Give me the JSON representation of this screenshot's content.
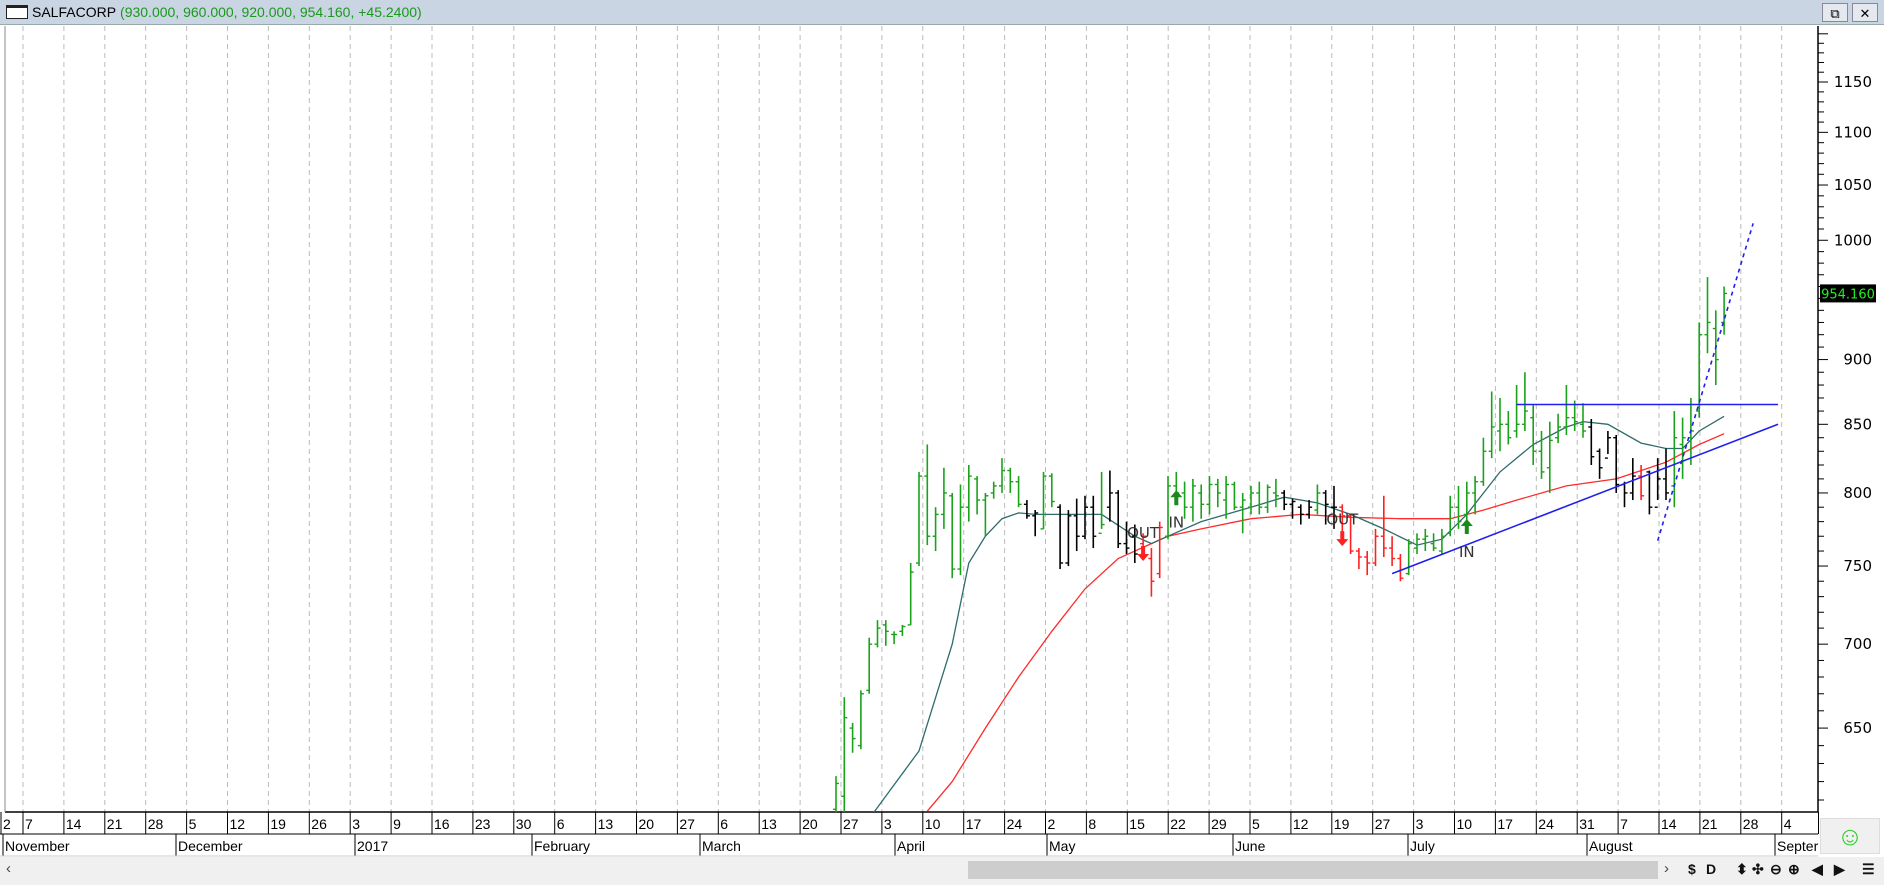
{
  "window": {
    "symbol": "SALFACORP",
    "quote": "(930.000, 960.000, 920.000, 954.160, +45.2400)",
    "restore_icon": "restore-icon",
    "close_icon": "close-icon"
  },
  "colors": {
    "up": "#1aa31a",
    "flat": "#000000",
    "down": "#ff2020",
    "ma_fast": "#2f6b6b",
    "ma_slow": "#ff2a2a",
    "trendline": "#2020ee",
    "grid": "#bbbbbb"
  },
  "chart_data": {
    "type": "ohlc",
    "title": "SALFACORP",
    "yscale": "log",
    "ylim": [
      604,
      1204
    ],
    "yticks": [
      650,
      700,
      750,
      800,
      850,
      900,
      1000,
      1050,
      1100,
      1150
    ],
    "last_price": "954.160",
    "week_labels": [
      "2",
      "7",
      "14",
      "21",
      "28",
      "5",
      "12",
      "19",
      "26",
      "3",
      "9",
      "16",
      "23",
      "30",
      "6",
      "13",
      "20",
      "27",
      "6",
      "13",
      "20",
      "27",
      "3",
      "10",
      "17",
      "24",
      "2",
      "8",
      "15",
      "22",
      "29",
      "5",
      "12",
      "19",
      "27",
      "3",
      "10",
      "17",
      "24",
      "31",
      "7",
      "14",
      "21",
      "28",
      "4"
    ],
    "month_labels": [
      "November",
      "December",
      "2017",
      "February",
      "March",
      "April",
      "May",
      "June",
      "July",
      "August",
      "Septer"
    ],
    "bars": [
      [
        605,
        623,
        598,
        619,
        "g"
      ],
      [
        612,
        668,
        600,
        656,
        "g"
      ],
      [
        650,
        653,
        636,
        644,
        "g"
      ],
      [
        640,
        672,
        638,
        670,
        "g"
      ],
      [
        672,
        704,
        670,
        700,
        "g"
      ],
      [
        700,
        715,
        698,
        710,
        "g"
      ],
      [
        712,
        715,
        699,
        708,
        "g"
      ],
      [
        706,
        708,
        700,
        706,
        "g"
      ],
      [
        708,
        712,
        705,
        711,
        "g"
      ],
      [
        712,
        752,
        712,
        746,
        "g"
      ],
      [
        752,
        815,
        750,
        812,
        "g"
      ],
      [
        812,
        835,
        764,
        770,
        "g"
      ],
      [
        770,
        790,
        760,
        785,
        "g"
      ],
      [
        785,
        818,
        775,
        800,
        "g"
      ],
      [
        798,
        800,
        742,
        748,
        "g"
      ],
      [
        748,
        806,
        744,
        790,
        "g"
      ],
      [
        790,
        820,
        780,
        812,
        "g"
      ],
      [
        810,
        812,
        785,
        795,
        "g"
      ],
      [
        795,
        800,
        770,
        798,
        "g"
      ],
      [
        800,
        808,
        796,
        805,
        "g"
      ],
      [
        805,
        825,
        800,
        816,
        "g"
      ],
      [
        816,
        818,
        800,
        808,
        "g"
      ],
      [
        808,
        812,
        790,
        792,
        "g"
      ],
      [
        792,
        795,
        782,
        784,
        "k"
      ],
      [
        784,
        788,
        770,
        786,
        "k"
      ],
      [
        775,
        815,
        775,
        812,
        "g"
      ],
      [
        812,
        814,
        790,
        794,
        "g"
      ],
      [
        790,
        792,
        748,
        752,
        "k"
      ],
      [
        752,
        788,
        750,
        784,
        "k"
      ],
      [
        784,
        796,
        760,
        770,
        "k"
      ],
      [
        770,
        798,
        768,
        790,
        "k"
      ],
      [
        790,
        798,
        762,
        770,
        "k"
      ],
      [
        772,
        815,
        775,
        778,
        "g"
      ],
      [
        790,
        816,
        780,
        800,
        "k"
      ],
      [
        800,
        802,
        762,
        765,
        "k"
      ],
      [
        765,
        780,
        758,
        762,
        "k"
      ],
      [
        770,
        778,
        752,
        758,
        "k"
      ],
      [
        765,
        772,
        758,
        770,
        "r"
      ],
      [
        755,
        762,
        730,
        740,
        "r"
      ],
      [
        745,
        780,
        742,
        776,
        "r"
      ],
      [
        770,
        812,
        768,
        805,
        "g"
      ],
      [
        805,
        815,
        795,
        800,
        "g"
      ],
      [
        800,
        808,
        782,
        790,
        "g"
      ],
      [
        790,
        810,
        780,
        805,
        "g"
      ],
      [
        800,
        806,
        782,
        792,
        "g"
      ],
      [
        792,
        812,
        785,
        806,
        "g"
      ],
      [
        806,
        810,
        790,
        800,
        "g"
      ],
      [
        795,
        812,
        782,
        806,
        "g"
      ],
      [
        806,
        808,
        788,
        790,
        "g"
      ],
      [
        790,
        800,
        772,
        795,
        "g"
      ],
      [
        790,
        805,
        785,
        800,
        "g"
      ],
      [
        800,
        808,
        785,
        790,
        "g"
      ],
      [
        790,
        806,
        786,
        804,
        "g"
      ],
      [
        800,
        810,
        790,
        798,
        "g"
      ],
      [
        800,
        802,
        788,
        792,
        "k"
      ],
      [
        792,
        796,
        782,
        794,
        "k"
      ],
      [
        790,
        792,
        778,
        785,
        "k"
      ],
      [
        785,
        795,
        782,
        790,
        "k"
      ],
      [
        788,
        806,
        785,
        800,
        "g"
      ],
      [
        800,
        802,
        778,
        792,
        "k"
      ],
      [
        790,
        805,
        775,
        790,
        "k"
      ],
      [
        790,
        792,
        770,
        784,
        "r"
      ],
      [
        784,
        785,
        758,
        760,
        "r"
      ],
      [
        760,
        762,
        748,
        756,
        "r"
      ],
      [
        756,
        760,
        744,
        752,
        "r"
      ],
      [
        752,
        775,
        750,
        770,
        "r"
      ],
      [
        770,
        798,
        756,
        762,
        "r"
      ],
      [
        762,
        770,
        750,
        755,
        "r"
      ],
      [
        755,
        758,
        740,
        742,
        "r"
      ],
      [
        745,
        768,
        744,
        765,
        "g"
      ],
      [
        762,
        772,
        758,
        768,
        "g"
      ],
      [
        768,
        775,
        760,
        770,
        "g"
      ],
      [
        765,
        772,
        760,
        762,
        "g"
      ],
      [
        760,
        775,
        758,
        770,
        "g"
      ],
      [
        772,
        798,
        770,
        790,
        "g"
      ],
      [
        790,
        805,
        775,
        780,
        "g"
      ],
      [
        785,
        808,
        780,
        800,
        "g"
      ],
      [
        800,
        812,
        785,
        808,
        "g"
      ],
      [
        808,
        840,
        805,
        830,
        "g"
      ],
      [
        830,
        875,
        825,
        848,
        "g"
      ],
      [
        845,
        870,
        830,
        850,
        "g"
      ],
      [
        850,
        860,
        835,
        840,
        "g"
      ],
      [
        845,
        880,
        840,
        850,
        "g"
      ],
      [
        850,
        890,
        845,
        860,
        "g"
      ],
      [
        855,
        865,
        820,
        830,
        "g"
      ],
      [
        830,
        845,
        810,
        815,
        "g"
      ],
      [
        818,
        852,
        800,
        838,
        "g"
      ],
      [
        840,
        858,
        836,
        848,
        "g"
      ],
      [
        848,
        880,
        842,
        855,
        "g"
      ],
      [
        855,
        868,
        845,
        852,
        "g"
      ],
      [
        850,
        866,
        840,
        845,
        "g"
      ],
      [
        848,
        854,
        820,
        826,
        "k"
      ],
      [
        830,
        832,
        810,
        818,
        "k"
      ],
      [
        825,
        845,
        828,
        840,
        "k"
      ],
      [
        840,
        842,
        800,
        806,
        "k"
      ],
      [
        806,
        808,
        790,
        800,
        "k"
      ],
      [
        800,
        825,
        795,
        812,
        "k"
      ],
      [
        812,
        820,
        795,
        798,
        "r"
      ],
      [
        815,
        816,
        785,
        790,
        "k"
      ],
      [
        790,
        825,
        795,
        810,
        "k"
      ],
      [
        810,
        832,
        795,
        800,
        "k"
      ],
      [
        805,
        860,
        790,
        840,
        "g"
      ],
      [
        835,
        855,
        810,
        840,
        "g"
      ],
      [
        840,
        870,
        820,
        845,
        "g"
      ],
      [
        860,
        930,
        855,
        920,
        "g"
      ],
      [
        920,
        968,
        905,
        930,
        "g"
      ],
      [
        925,
        940,
        880,
        900,
        "g"
      ],
      [
        930,
        960,
        920,
        954.16,
        "g"
      ]
    ],
    "ma_fast": [
      [
        4,
        600
      ],
      [
        10,
        637
      ],
      [
        14,
        700
      ],
      [
        16,
        752
      ],
      [
        18,
        770
      ],
      [
        20,
        782
      ],
      [
        22,
        786
      ],
      [
        24,
        785
      ],
      [
        32,
        785
      ],
      [
        36,
        770
      ],
      [
        38,
        765
      ],
      [
        40,
        770
      ],
      [
        44,
        780
      ],
      [
        50,
        790
      ],
      [
        54,
        797
      ],
      [
        58,
        793
      ],
      [
        62,
        785
      ],
      [
        66,
        775
      ],
      [
        70,
        764
      ],
      [
        73,
        768
      ],
      [
        76,
        785
      ],
      [
        80,
        815
      ],
      [
        84,
        835
      ],
      [
        88,
        848
      ],
      [
        90,
        852
      ],
      [
        93,
        850
      ],
      [
        97,
        836
      ],
      [
        100,
        832
      ],
      [
        102,
        832
      ],
      [
        104,
        845
      ],
      [
        107,
        856
      ]
    ],
    "ma_slow": [
      [
        11,
        604
      ],
      [
        14,
        620
      ],
      [
        18,
        650
      ],
      [
        22,
        680
      ],
      [
        26,
        708
      ],
      [
        30,
        735
      ],
      [
        34,
        755
      ],
      [
        38,
        765
      ],
      [
        40,
        770
      ],
      [
        44,
        775
      ],
      [
        50,
        782
      ],
      [
        56,
        785
      ],
      [
        62,
        783
      ],
      [
        68,
        782
      ],
      [
        74,
        782
      ],
      [
        78,
        788
      ],
      [
        82,
        795
      ],
      [
        88,
        805
      ],
      [
        94,
        810
      ],
      [
        100,
        822
      ],
      [
        104,
        835
      ],
      [
        107,
        843
      ]
    ],
    "trendlines": [
      {
        "from": [
          82,
          865
        ],
        "to": [
          113.5,
          865
        ],
        "style": "solid"
      },
      {
        "from": [
          67,
          745
        ],
        "to": [
          113.5,
          850
        ],
        "style": "solid"
      },
      {
        "from": [
          99,
          767
        ],
        "to": [
          110.5,
          1015
        ],
        "style": "dotted"
      }
    ],
    "signals": [
      {
        "label": "OUT",
        "index": 37,
        "text_price": 773,
        "arrow_price": 758,
        "dir": "down"
      },
      {
        "label": "IN",
        "index": 41,
        "text_price": 780,
        "arrow_price": 797,
        "dir": "up"
      },
      {
        "label": "OUT",
        "index": 61,
        "text_price": 782,
        "arrow_price": 768,
        "dir": "down"
      },
      {
        "label": "IN",
        "index": 76,
        "text_price": 760,
        "arrow_price": 777,
        "dir": "up"
      }
    ]
  },
  "scrollbar": {
    "left": "‹",
    "right": "›"
  },
  "toolbar": [
    "$",
    "D",
    "⬍",
    "✣",
    "⊖",
    "⊕",
    "◀",
    "▶",
    "☰"
  ],
  "status": {
    "smiley": "☺"
  }
}
